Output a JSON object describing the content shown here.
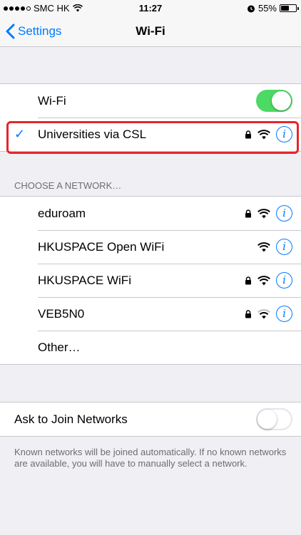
{
  "status_bar": {
    "carrier": "SMC HK",
    "time": "11:27",
    "battery": "55%",
    "battery_level": 0.55
  },
  "nav": {
    "back_label": "Settings",
    "title": "Wi-Fi"
  },
  "wifi_toggle": {
    "label": "Wi-Fi",
    "on": true
  },
  "connected_network": {
    "name": "Universities via CSL",
    "locked": true
  },
  "choose_header": "CHOOSE A NETWORK…",
  "networks": [
    {
      "name": "eduroam",
      "locked": true
    },
    {
      "name": "HKUSPACE Open WiFi",
      "locked": false
    },
    {
      "name": "HKUSPACE WiFi",
      "locked": true
    },
    {
      "name": "VEB5N0",
      "locked": true
    }
  ],
  "other_label": "Other…",
  "ask_to_join": {
    "label": "Ask to Join Networks",
    "on": false
  },
  "footer_note": "Known networks will be joined automatically. If no known networks are available, you will have to manually select a network.",
  "colors": {
    "accent": "#007aff",
    "toggle_on": "#4cd964",
    "highlight": "#e5252a"
  }
}
